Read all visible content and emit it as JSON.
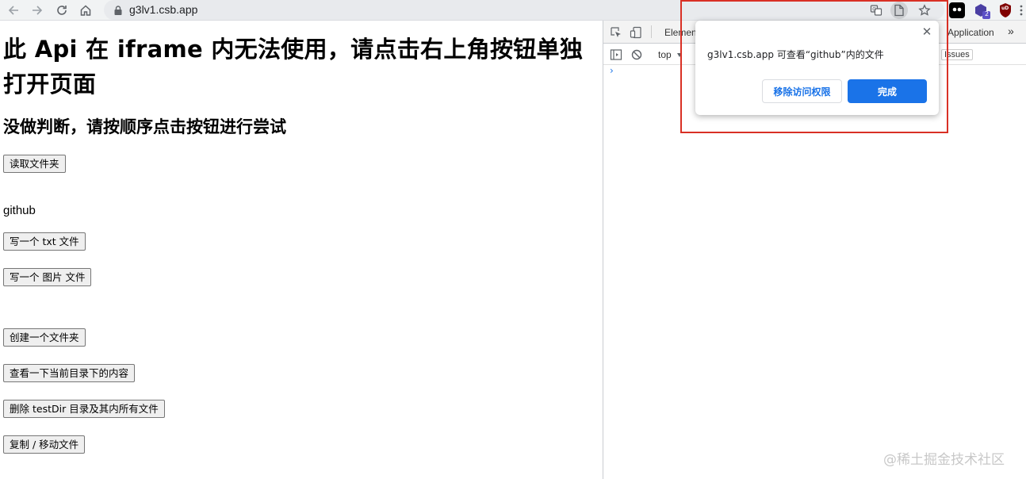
{
  "browser": {
    "url": "g3lv1.csb.app",
    "ext_badge": "2",
    "ext_ub_label": "uD"
  },
  "page": {
    "title": "此 Api 在 iframe 内无法使用，请点击右上角按钮单独打开页面",
    "subtitle": "没做判断，请按顺序点击按钮进行尝试",
    "buttons": {
      "read_folder": "读取文件夹",
      "write_txt": "写一个 txt 文件",
      "write_image": "写一个 图片 文件",
      "create_folder": "创建一个文件夹",
      "view_dir": "查看一下当前目录下的内容",
      "delete_testdir": "删除 testDir 目录及其内所有文件",
      "copy_move": "复制 / 移动文件"
    },
    "folder_name": "github"
  },
  "devtools": {
    "tab_elements": "Elemen",
    "tab_application": "Application",
    "context": "top",
    "issues": "Issues",
    "more": "»"
  },
  "popup": {
    "message": "g3lv1.csb.app 可查看“github”内的文件",
    "remove_access": "移除访问权限",
    "done": "完成",
    "close": "✕"
  },
  "watermark": "@稀土掘金技术社区"
}
